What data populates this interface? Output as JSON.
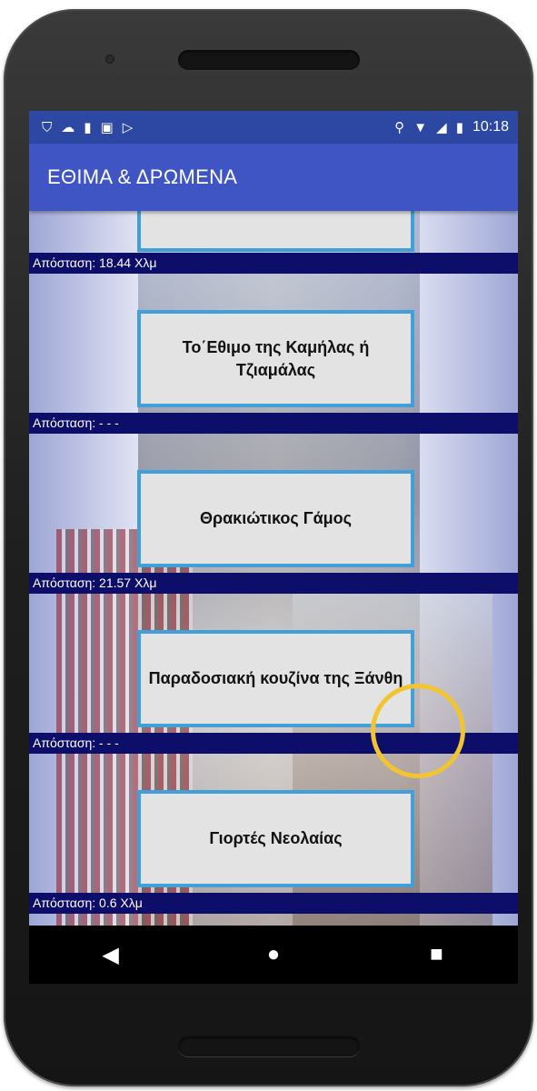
{
  "status_bar": {
    "icons_left": [
      "shield-icon",
      "cloud-icon",
      "sd-card-icon",
      "photo-icon",
      "play-store-icon"
    ],
    "icons_right": [
      "location-icon",
      "wifi-icon",
      "signal-icon",
      "battery-icon"
    ],
    "time": "10:18"
  },
  "app_bar": {
    "title": "ΕΘΙΜΑ & ΔΡΩΜΕΝΑ"
  },
  "items": [
    {
      "title": "",
      "distance": "Απόσταση: 18.44 Χλμ"
    },
    {
      "title": "Το΄Εθιμο της Καμήλας ή Τζιαμάλας",
      "distance": "Απόσταση: - - -"
    },
    {
      "title": "Θρακιώτικος Γάμος",
      "distance": "Απόσταση: 21.57 Χλμ"
    },
    {
      "title": "Παραδοσιακή κουζίνα της Ξάνθη",
      "distance": "Απόσταση: - - -"
    },
    {
      "title": "Γιορτές Νεολαίας",
      "distance": "Απόσταση: 0.6 Χλμ"
    }
  ],
  "nav_bar": {
    "back": "◀",
    "home": "●",
    "recents": "■"
  },
  "colors": {
    "status_bar": "#2d48a2",
    "app_bar": "#3f55c3",
    "card_border": "#42a0d8",
    "distance_bar": "#0c0e6a",
    "tap_indicator": "#f2c530"
  }
}
